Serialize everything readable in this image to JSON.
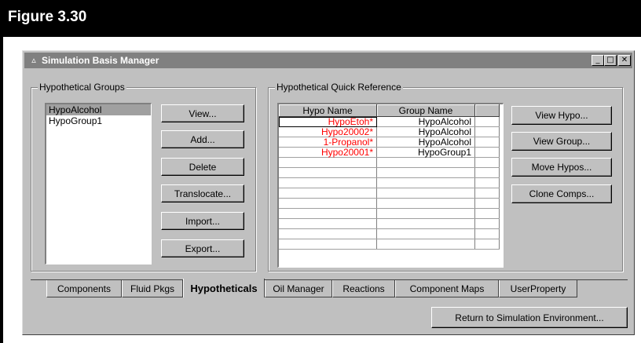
{
  "figure": {
    "title": "Figure 3.30"
  },
  "window": {
    "title": "Simulation Basis Manager",
    "icon": "triangle-app-icon",
    "controls": [
      "minimize",
      "maximize",
      "close"
    ]
  },
  "groups": {
    "label": "Hypothetical Groups",
    "items": [
      "HypoAlcohol",
      "HypoGroup1"
    ],
    "selected": "HypoAlcohol",
    "buttons": {
      "view": "View...",
      "add": "Add...",
      "delete": "Delete",
      "translocate": "Translocate...",
      "import": "Import...",
      "export": "Export..."
    }
  },
  "quickref": {
    "label": "Hypothetical Quick Reference",
    "columns": [
      "Hypo Name",
      "Group Name"
    ],
    "rows": [
      {
        "name": "HypoEtoh*",
        "group": "HypoAlcohol"
      },
      {
        "name": "Hypo20002*",
        "group": "HypoAlcohol"
      },
      {
        "name": "1-Propanol*",
        "group": "HypoAlcohol"
      },
      {
        "name": "Hypo20001*",
        "group": "HypoGroup1"
      }
    ],
    "buttons": {
      "view_hypo": "View Hypo...",
      "view_group": "View Group...",
      "move_hypos": "Move Hypos...",
      "clone_comps": "Clone Comps..."
    }
  },
  "tabs": [
    {
      "label": "Components"
    },
    {
      "label": "Fluid Pkgs"
    },
    {
      "label": "Hypotheticals"
    },
    {
      "label": "Oil Manager"
    },
    {
      "label": "Reactions"
    },
    {
      "label": "Component Maps"
    },
    {
      "label": "UserProperty"
    }
  ],
  "active_tab": "Hypotheticals",
  "footer": {
    "return_button": "Return to Simulation Environment..."
  },
  "colors": {
    "hypo_name_text": "#ff0000",
    "titlebar": "#808080",
    "dialog_face": "#c0c0c0"
  }
}
